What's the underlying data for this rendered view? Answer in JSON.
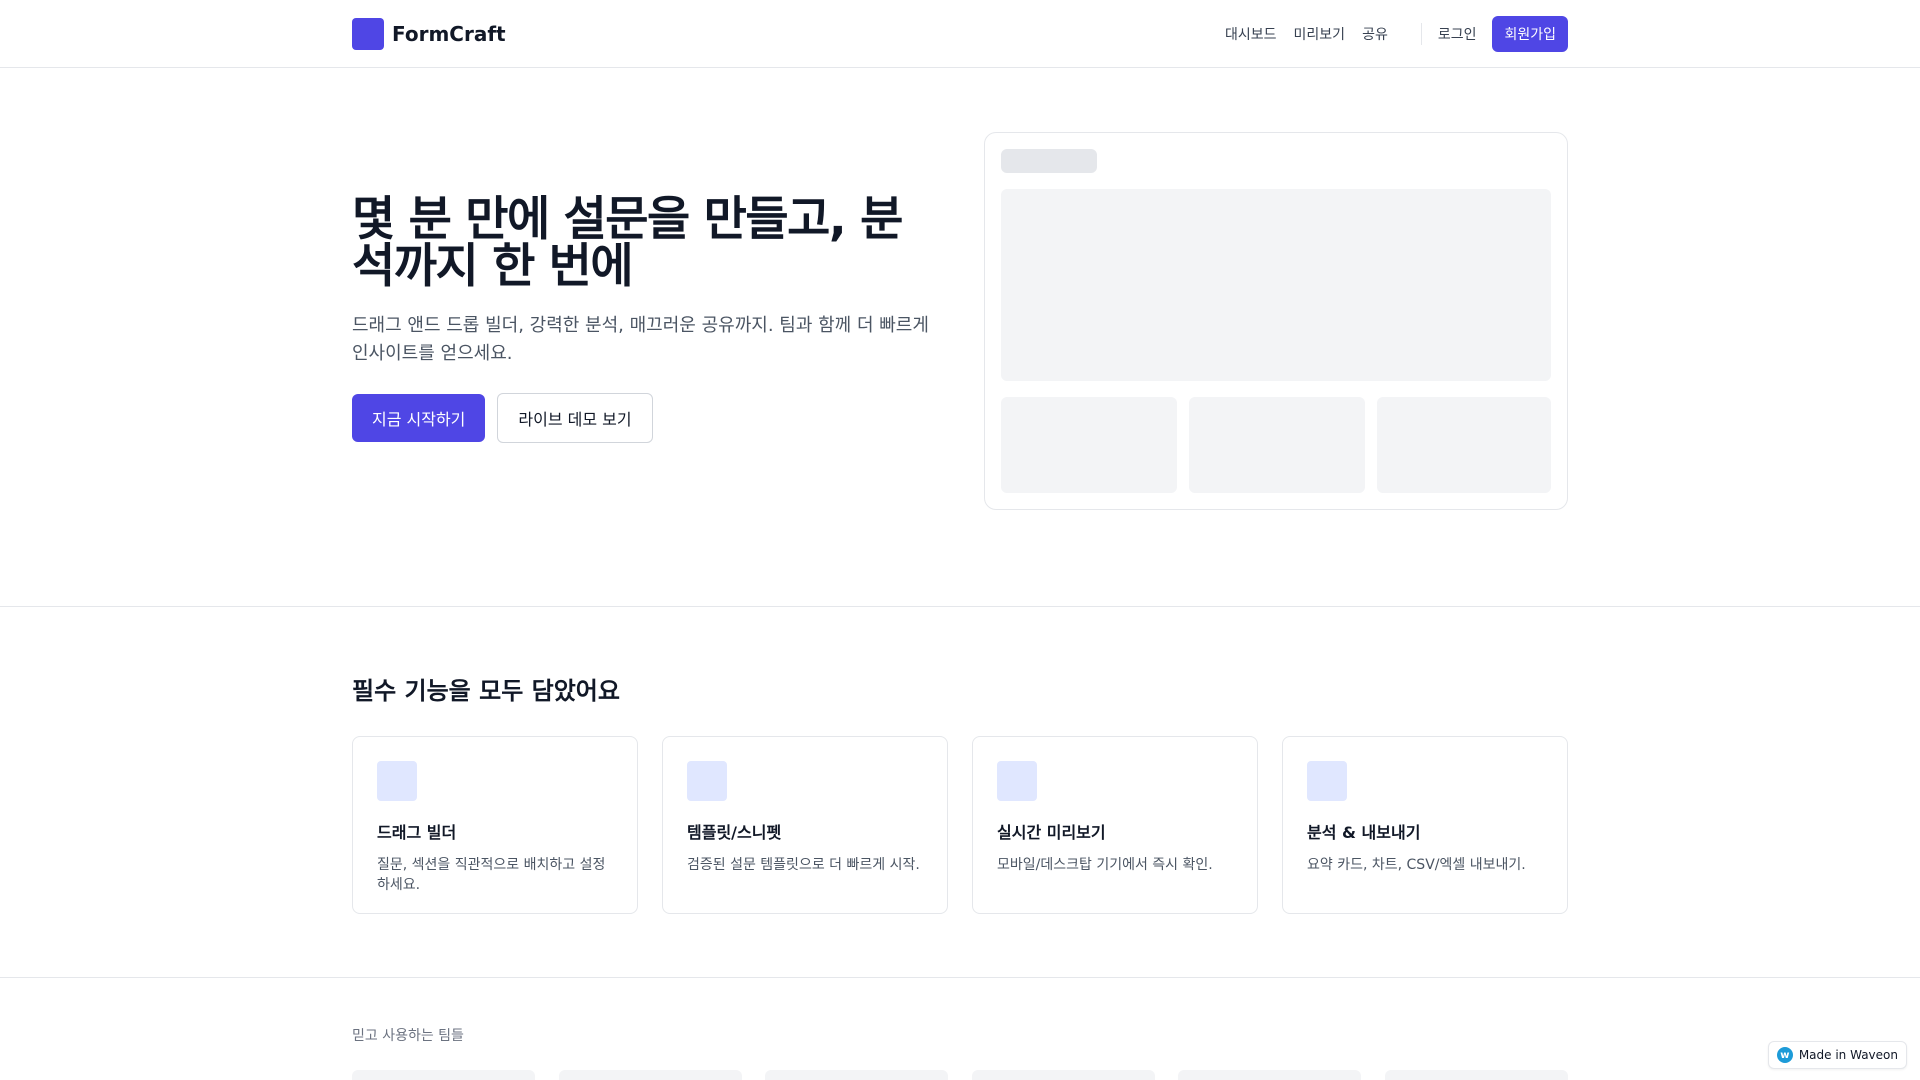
{
  "brand": {
    "name": "FormCraft",
    "accent_color": "#4f46e5"
  },
  "nav": {
    "links": [
      "대시보드",
      "미리보기",
      "공유"
    ],
    "login": "로그인",
    "signup": "회원가입"
  },
  "hero": {
    "title": "몇 분 만에 설문을 만들고, 분석까지 한 번에",
    "subtitle": "드래그 앤드 드롭 빌더, 강력한 분석, 매끄러운 공유까지. 팀과 함께 더 빠르게 인사이트를 얻으세요.",
    "cta_primary": "지금 시작하기",
    "cta_secondary": "라이브 데모 보기"
  },
  "features": {
    "title": "필수 기능을 모두 담았어요",
    "items": [
      {
        "title": "드래그 빌더",
        "desc": "질문, 섹션을 직관적으로 배치하고 설정하세요."
      },
      {
        "title": "템플릿/스니펫",
        "desc": "검증된 설문 템플릿으로 더 빠르게 시작."
      },
      {
        "title": "실시간 미리보기",
        "desc": "모바일/데스크탑 기기에서 즉시 확인."
      },
      {
        "title": "분석 & 내보내기",
        "desc": "요약 카드, 차트, CSV/엑셀 내보내기."
      }
    ]
  },
  "trusted": {
    "label": "믿고 사용하는 팀들"
  },
  "badge": {
    "icon": "waveon-logo-icon",
    "icon_glyph": "w",
    "text": "Made in Waveon"
  }
}
